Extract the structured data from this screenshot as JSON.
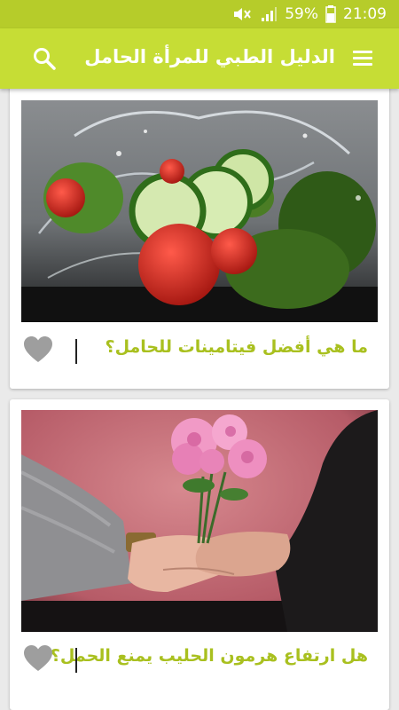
{
  "status_bar": {
    "battery_percent": "59%",
    "time": "21:09",
    "icons": [
      "mute-icon",
      "signal-icon",
      "battery-icon"
    ],
    "color": "#b6cc2a"
  },
  "app_bar": {
    "title": "الدليل الطبي للمرأة الحامل",
    "icons": [
      "menu-icon",
      "search-icon"
    ],
    "color": "#c6dd35"
  },
  "articles": [
    {
      "title": "ما هي أفضل فيتامينات للحامل؟",
      "image": "salad-vegetables-photo",
      "favorite_icon": "heart-icon"
    },
    {
      "title": "هل ارتفاع هرمون الحليب يمنع الحمل؟",
      "image": "hands-pink-roses-photo",
      "favorite_icon": "heart-icon"
    }
  ],
  "theme": {
    "accent": "#a9c01f",
    "heart": "#9e9e9e"
  }
}
